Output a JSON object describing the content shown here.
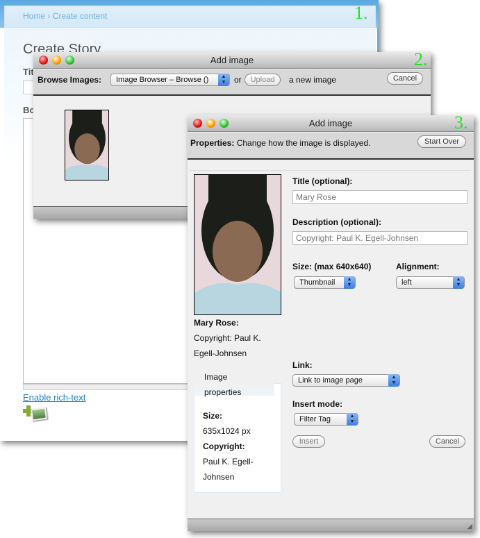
{
  "window1": {
    "step": "1.",
    "breadcrumb_home": "Home",
    "breadcrumb_sep": "›",
    "breadcrumb_current": "Create content",
    "page_title": "Create Story",
    "title_label": "Title",
    "body_label": "Body",
    "enable_rich_text": "Enable rich-text",
    "add_image_icon": "add-image-icon"
  },
  "window2": {
    "step": "2.",
    "title": "Add image",
    "browse_label": "Browse Images:",
    "browse_select": "Image Browser – Browse ()",
    "or": "or",
    "upload": "Upload",
    "new_image": "a new image",
    "cancel": "Cancel"
  },
  "window3": {
    "step": "3.",
    "title": "Add image",
    "properties_label": "Properties:",
    "properties_desc": "Change how the image is displayed.",
    "start_over": "Start Over",
    "caption_title": "Mary Rose:",
    "caption_copy1": "Copyright: Paul K.",
    "caption_copy2": "Egell-Johnsen",
    "props_tab1": "Image",
    "props_tab2": "properties",
    "size_label": "Size:",
    "size_value": "635x1024 px",
    "copyright_label": "Copyright:",
    "copyright_v1": "Paul K. Egell-",
    "copyright_v2": "Johnsen",
    "title_field_label": "Title (optional):",
    "title_value": "Mary Rose",
    "desc_label": "Description (optional):",
    "desc_value": "Copyright: Paul K. Egell-Johnsen",
    "size_select_label": "Size: (max 640x640)",
    "size_select": "Thumbnail",
    "align_label": "Alignment:",
    "align_select": "left",
    "link_label": "Link:",
    "link_select": "Link to image page",
    "insert_mode_label": "Insert mode:",
    "insert_mode_select": "Filter Tag",
    "insert": "Insert",
    "cancel": "Cancel"
  }
}
